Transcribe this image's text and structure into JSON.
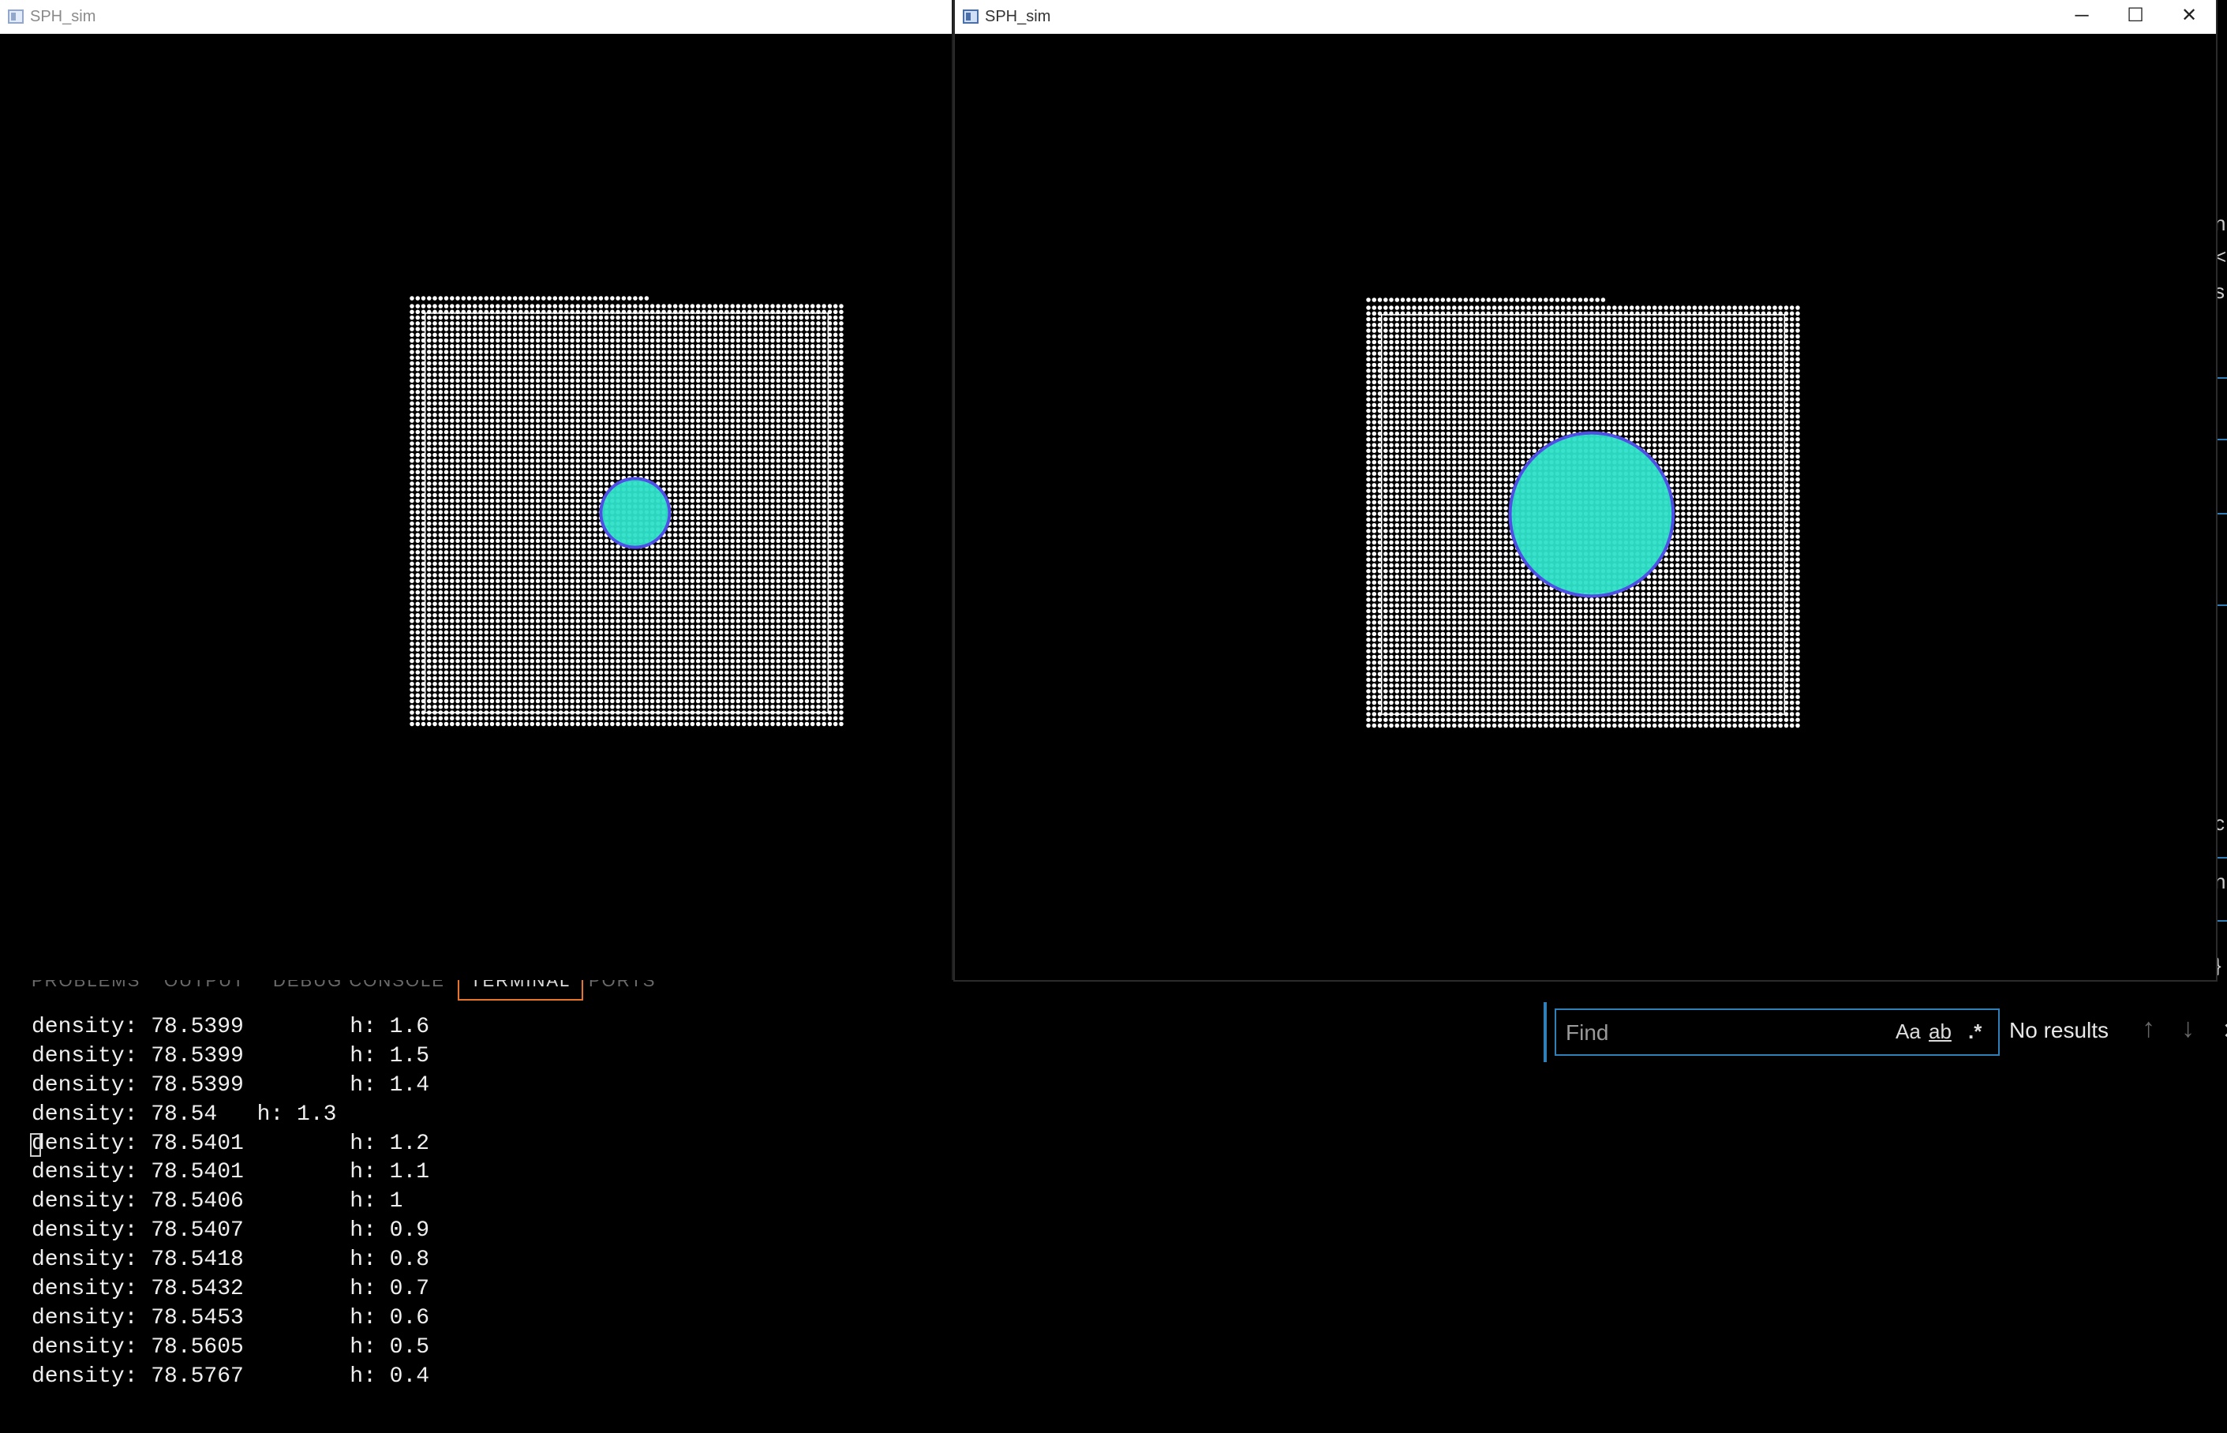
{
  "windows": {
    "left": {
      "title": "SPH_sim",
      "kernel_radius_fraction": 0.16
    },
    "right": {
      "title": "SPH_sim",
      "controls": {
        "minimize": "─",
        "maximize": "☐",
        "close": "✕"
      },
      "kernel_radius_fraction": 0.38
    },
    "particle_grid": {
      "columns": 76,
      "rows": 75,
      "particle_color": "#ffffff"
    },
    "kernel": {
      "fill": "#2ee0c8",
      "stroke": "#4f4fe6"
    }
  },
  "terminal": {
    "tabs": [
      "PROBLEMS",
      "OUTPUT",
      "DEBUG CONSOLE",
      "TERMINAL",
      "PORTS"
    ],
    "active_tab": "TERMINAL",
    "lines": [
      {
        "density": "78.5399",
        "h": "1.6"
      },
      {
        "density": "78.5399",
        "h": "1.5"
      },
      {
        "density": "78.5399",
        "h": "1.4"
      },
      {
        "density": "78.54",
        "h": "1.3"
      },
      {
        "density": "78.5401",
        "h": "1.2"
      },
      {
        "density": "78.5401",
        "h": "1.1"
      },
      {
        "density": "78.5406",
        "h": "1"
      },
      {
        "density": "78.5407",
        "h": "0.9"
      },
      {
        "density": "78.5418",
        "h": "0.8"
      },
      {
        "density": "78.5432",
        "h": "0.7"
      },
      {
        "density": "78.5453",
        "h": "0.6"
      },
      {
        "density": "78.5605",
        "h": "0.5"
      },
      {
        "density": "78.5767",
        "h": "0.4"
      }
    ],
    "cursor_line": 4
  },
  "find": {
    "placeholder": "Find",
    "match_case": "Aa",
    "whole_word": "ab",
    "regex": ".*",
    "status": "No results",
    "prev": "↑",
    "next": "↓",
    "close": "✕"
  },
  "editor_peek": {
    "chars": [
      "n",
      "<",
      "s",
      "c",
      "n",
      "}"
    ]
  },
  "colors": {
    "accent": "#2f7fb8",
    "active_tab_border": "#e8742c",
    "background": "#000000"
  }
}
